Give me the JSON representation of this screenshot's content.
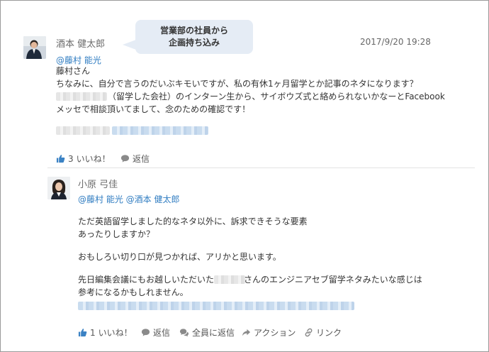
{
  "annotation": {
    "line1": "営業部の社員から",
    "line2": "企画持ち込み"
  },
  "post": {
    "author": "酒本 健太郎",
    "timestamp": "2017/9/20 19:28",
    "mention": "@藤村 能光",
    "lines": [
      "藤村さん",
      "ちなみに、自分で言うのだいぶキモいですが、私の有休1ヶ月留学とか記事のネタになります？",
      "（留学した会社）のインターン生から、サイボウズ式と絡められないかなーとFacebook",
      "メッセで相談頂いてまして、念のための確認です！"
    ],
    "actions": {
      "like_count": "3",
      "like_label": "いいね！",
      "reply_label": "返信"
    }
  },
  "reply": {
    "author": "小原 弓佳",
    "mentions": "@藤村 能光 @酒本 健太郎",
    "lines": [
      "ただ英語留学しました的なネタ以外に、訴求できそうな要素",
      "あったりしますか？",
      "",
      "おもしろい切り口が見つかれば、アリかと思います。",
      "",
      "先日編集会議にもお越しいただいた",
      "さんのエンジニアセブ留学ネタみたいな感じは",
      "参考になるかもしれません。"
    ],
    "actions": {
      "like_count": "1",
      "like_label": "いいね！",
      "reply_label": "返信",
      "reply_all_label": "全員に返信",
      "action_label": "アクション",
      "link_label": "リンク"
    }
  },
  "colors": {
    "link": "#2f7cc1",
    "bubble": "#e5ecf5",
    "like_icon": "#3b82c4"
  }
}
